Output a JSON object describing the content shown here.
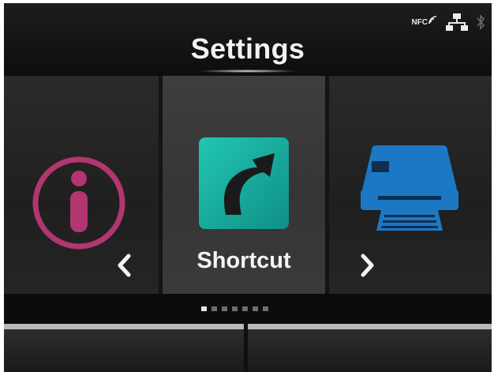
{
  "header": {
    "title": "Settings",
    "status_icons": {
      "nfc_label": "NFC",
      "network": "lan-icon",
      "bluetooth": "bluetooth-icon"
    }
  },
  "carousel": {
    "items": [
      {
        "icon": "info-icon",
        "color": "#b2366f"
      },
      {
        "icon": "shortcut-arrow-icon",
        "label": "Shortcut",
        "color": "#18a89c"
      },
      {
        "icon": "printer-icon",
        "color": "#1c78c4"
      }
    ],
    "selected_index": 1,
    "prev_icon": "chevron-left-icon",
    "next_icon": "chevron-right-icon"
  },
  "pagination": {
    "total": 7,
    "current": 1
  },
  "softkeys": {
    "left": "",
    "right": ""
  }
}
